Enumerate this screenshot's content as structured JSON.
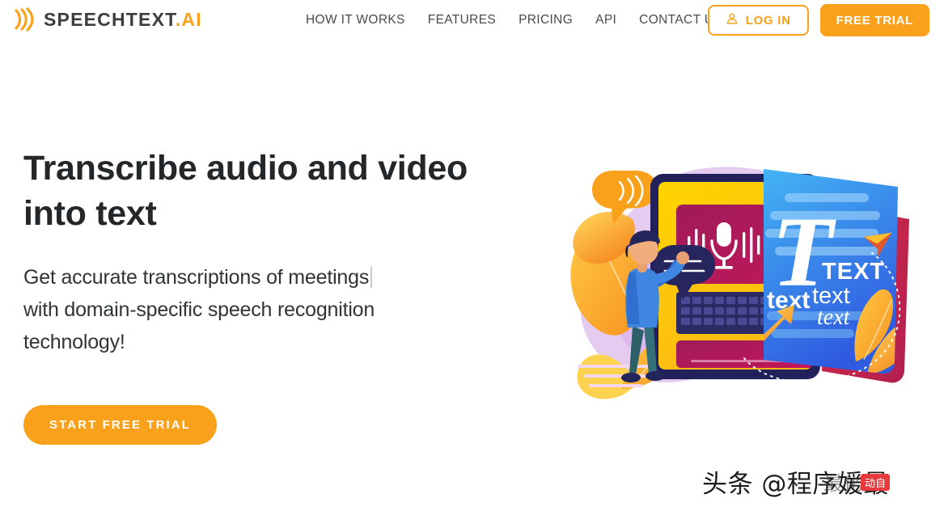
{
  "header": {
    "brand": {
      "name": "SPEECHTEXT",
      "suffix": ".AI",
      "logo_icon": "sound-wave-icon"
    },
    "nav": [
      {
        "label": "HOW IT WORKS"
      },
      {
        "label": "FEATURES"
      },
      {
        "label": "PRICING"
      },
      {
        "label": "API"
      },
      {
        "label": "CONTACT US"
      }
    ],
    "actions": {
      "login_label": "LOG IN",
      "login_icon": "user-icon",
      "free_trial_label": "FREE TRIAL"
    }
  },
  "hero": {
    "title_line1": "Transcribe audio and video",
    "title_line2": "into text",
    "subtitle_line1": "Get accurate transcriptions of meetings",
    "subtitle_line2": "with domain-specific speech recognition",
    "subtitle_line3": "technology!",
    "cta_label": "START FREE TRIAL",
    "illustration": {
      "name": "speech-to-text-illustration",
      "card_text_big": "T",
      "card_text_caps": "TEXT",
      "card_text_bold": "text",
      "card_text_regular": "text",
      "card_text_italic": "text"
    }
  },
  "watermark": {
    "main": "头条 @程序媛最",
    "ghost": "最化默",
    "badge": "动自"
  },
  "colors": {
    "brand_orange": "#f9a11b",
    "heading_dark": "#23272a",
    "nav_gray": "#4a4a4a",
    "page_background": "#ffffff",
    "watermark_badge_red": "#e8393c"
  }
}
